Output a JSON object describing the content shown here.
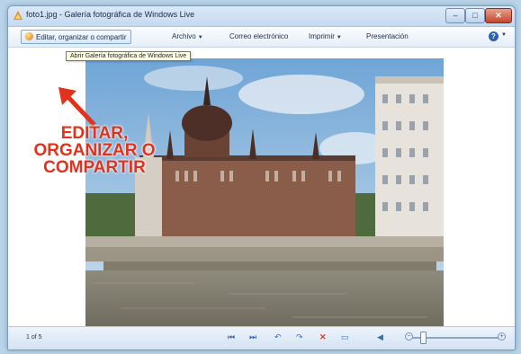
{
  "window": {
    "title": "foto1.jpg - Galería fotográfica de Windows Live",
    "minimize": "–",
    "maximize": "□",
    "close": "✕"
  },
  "menubar": {
    "edit_label": "Editar, organizar o compartir",
    "archivo": "Archivo",
    "correo": "Correo electrónico",
    "imprimir": "Imprimir",
    "presentacion": "Presentación",
    "help_glyph": "?",
    "caret": "▼"
  },
  "tooltip": "Abrir Galería fotográfica de Windows Live",
  "annotation": {
    "line1": "EDITAR,",
    "line2": "ORGANIZAR O",
    "line3": "COMPARTIR",
    "color": "#e2321b"
  },
  "statusbar": {
    "counter": "1 of 5",
    "prev": "⏮",
    "next": "⏭",
    "rotate_left": "↶",
    "rotate_right": "↷",
    "delete": "✕",
    "fit": "▭",
    "play": "◀",
    "zoom_minus": "−",
    "zoom_plus": "+"
  },
  "colors": {
    "accent": "#2a62b6",
    "titlebar": "#c4daf1"
  },
  "icons": [
    "gallery-app-icon",
    "edit-icon",
    "help-icon",
    "arrow-annotation",
    "prev-icon",
    "next-icon",
    "rotate-left-icon",
    "rotate-right-icon",
    "delete-icon",
    "fit-icon",
    "speaker-icon",
    "zoom-minus-icon",
    "zoom-plus-icon"
  ]
}
